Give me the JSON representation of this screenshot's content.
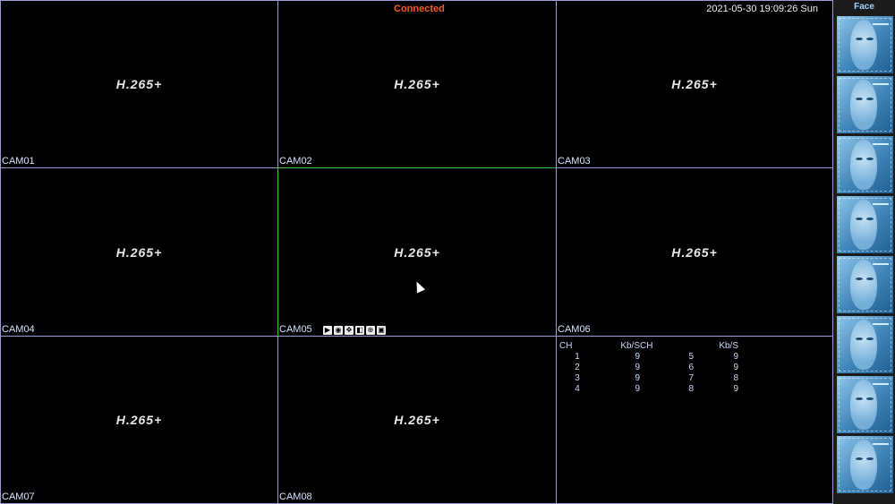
{
  "header": {
    "status": "Connected",
    "datetime": "2021-05-30 19:09:26 Sun"
  },
  "cameras": [
    {
      "label": "CAM01",
      "codec": "H.265+"
    },
    {
      "label": "CAM02",
      "codec": "H.265+"
    },
    {
      "label": "CAM03",
      "codec": "H.265+"
    },
    {
      "label": "CAM04",
      "codec": "H.265+"
    },
    {
      "label": "CAM05",
      "codec": "H.265+"
    },
    {
      "label": "CAM06",
      "codec": "H.265+"
    },
    {
      "label": "CAM07",
      "codec": "H.265+"
    },
    {
      "label": "CAM08",
      "codec": "H.265+"
    }
  ],
  "stats": {
    "headers": [
      "CH",
      "Kb/S",
      "CH",
      "Kb/S"
    ],
    "rows": [
      [
        "1",
        "9",
        "5",
        "9"
      ],
      [
        "2",
        "9",
        "6",
        "9"
      ],
      [
        "3",
        "9",
        "7",
        "8"
      ],
      [
        "4",
        "9",
        "8",
        "9"
      ]
    ]
  },
  "face_panel": {
    "title": "Face"
  },
  "colors": {
    "tile_border": "#9a9bd6",
    "active_border": "#39c23a",
    "status": "#ff5a1f"
  }
}
